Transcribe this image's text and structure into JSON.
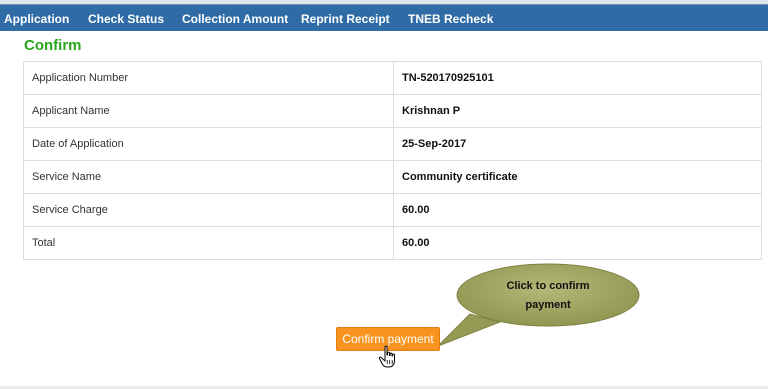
{
  "nav": {
    "items": [
      {
        "label": "Application"
      },
      {
        "label": "Check Status"
      },
      {
        "label": "Collection Amount"
      },
      {
        "label": "Reprint Receipt"
      },
      {
        "label": "TNEB Recheck"
      }
    ]
  },
  "heading": "Confirm",
  "details": {
    "rows": [
      {
        "label": "Application Number",
        "value": "TN-520170925101"
      },
      {
        "label": "Applicant Name",
        "value": "Krishnan P"
      },
      {
        "label": "Date of Application",
        "value": "25-Sep-2017"
      },
      {
        "label": "Service Name",
        "value": "Community certificate"
      },
      {
        "label": "Service Charge",
        "value": "60.00"
      },
      {
        "label": "Total",
        "value": "60.00"
      }
    ]
  },
  "callout": {
    "line1": "Click to confirm",
    "line2": "payment"
  },
  "confirm_button": "Confirm payment",
  "colors": {
    "nav_bg": "#2f6ca6",
    "heading": "#2aa61c",
    "button": "#f7931e",
    "callout": "#9aa05a"
  }
}
